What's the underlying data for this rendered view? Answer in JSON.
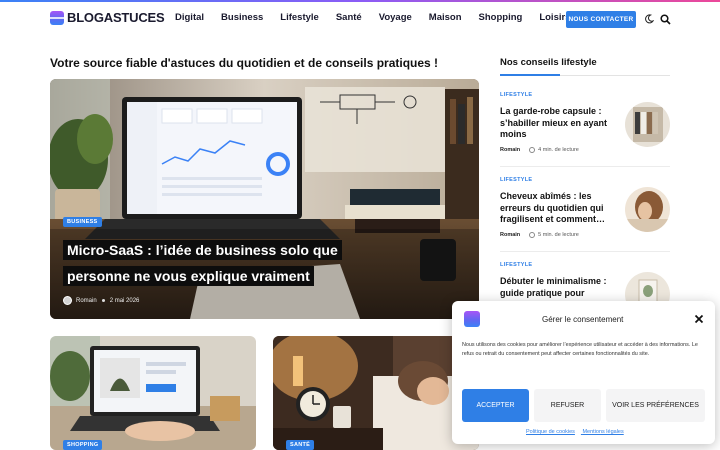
{
  "header": {
    "logo_text": "BLOGASTUCES",
    "nav": [
      "Digital",
      "Business",
      "Lifestyle",
      "Santé",
      "Voyage",
      "Maison",
      "Shopping",
      "Loisirs"
    ],
    "contact_label": "NOUS CONTACTER",
    "colors": {
      "accent": "#2f7fe6",
      "text": "#1a1a2e"
    }
  },
  "main": {
    "section_title": "Votre source fiable d'astuces du quotidien et de conseils pratiques !",
    "featured": {
      "category": "BUSINESS",
      "title_line1": "Micro-SaaS : l’idée de business solo que",
      "title_line2": "personne ne vous explique vraiment",
      "author": "Romain",
      "date": "2 mai 2026"
    },
    "cards": [
      {
        "category": "SHOPPING"
      },
      {
        "category": "SANTÉ"
      }
    ]
  },
  "sidebar": {
    "title": "Nos conseils lifestyle",
    "items": [
      {
        "category": "LIFESTYLE",
        "title": "La garde-robe capsule : s’habiller mieux en ayant moins",
        "author": "Romain",
        "read_time": "4 min. de lecture"
      },
      {
        "category": "LIFESTYLE",
        "title": "Cheveux abîmés : les erreurs du quotidien qui fragilisent et comment…",
        "author": "Romain",
        "read_time": "5 min. de lecture"
      },
      {
        "category": "LIFESTYLE",
        "title": "Débuter le minimalisme : guide pratique pour",
        "author": "",
        "read_time": ""
      }
    ]
  },
  "cookie": {
    "title": "Gérer le consentement",
    "text": "Nous utilisons des cookies pour améliorer l’expérience utilisateur et accéder à des informations. Le refus ou retrait du consentement peut affecter certaines fonctionnalités du site.",
    "accept": "ACCEPTER",
    "refuse": "REFUSER",
    "prefs": "VOIR LES PRÉFÉRENCES",
    "link_cookies": "Politique de cookies",
    "link_legal": "Mentions légales"
  }
}
